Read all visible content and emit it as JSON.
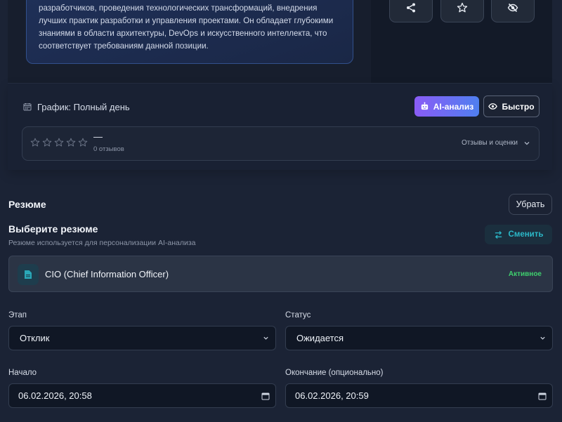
{
  "description": {
    "text": "разработчиков, проведения технологических трансформаций, внедрения лучших практик разработки и управления проектами. Он обладает глубокими знаниями в области архитектуры, DevOps и искусственного интеллекта, что соответствует требованиям данной позиции."
  },
  "actions": {
    "share_icon": "share-icon",
    "favorite_icon": "star-icon",
    "hide_icon": "eye-off-icon"
  },
  "job": {
    "schedule": "График: Полный день",
    "ai_button": "AI-анализ",
    "fast_button": "Быстро"
  },
  "reviews": {
    "stars_filled": 0,
    "stars_total": 5,
    "rating": "—",
    "count": "0 отзывов",
    "toggle": "Отзывы и оценки"
  },
  "resume": {
    "section_title": "Резюме",
    "remove_button": "Убрать",
    "choose_title": "Выберите резюме",
    "choose_subtitle": "Резюме используется для персонализации AI-анализа",
    "switch_button": "Сменить",
    "selected_name": "CIO (Chief Information Officer)",
    "selected_status": "Активное"
  },
  "form": {
    "stage_label": "Этап",
    "stage_value": "Отклик",
    "status_label": "Статус",
    "status_value": "Ожидается",
    "start_label": "Начало",
    "start_value": "06.02.2026, 20:58",
    "end_label": "Окончание (опционально)",
    "end_value": "06.02.2026, 20:59"
  },
  "colors": {
    "background": "#1b2335",
    "accent_teal": "#2bb8c8",
    "active_green": "#3fcf6e",
    "ai_gradient_start": "#8a5cf6",
    "ai_gradient_end": "#4f7ff0"
  }
}
